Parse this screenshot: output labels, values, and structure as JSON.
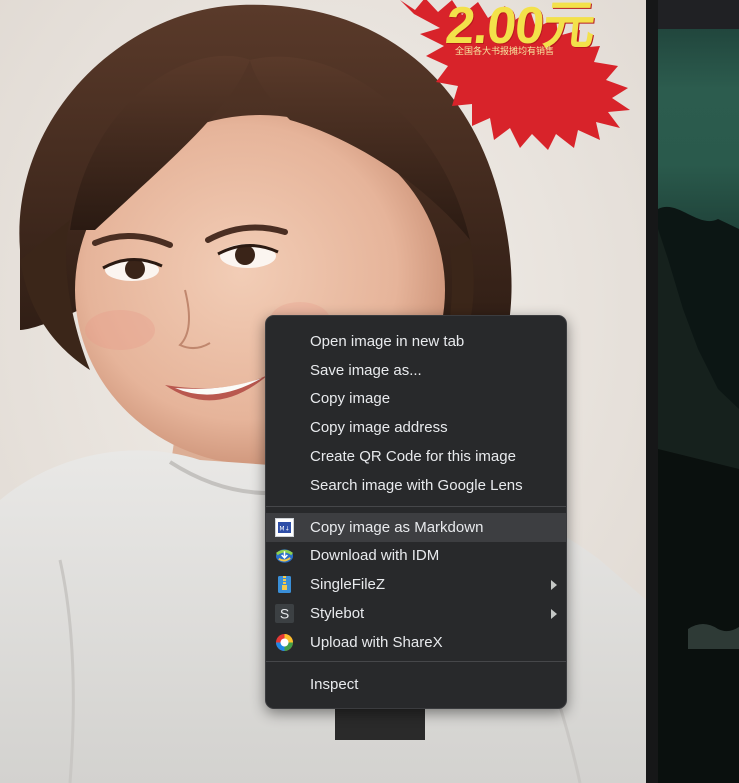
{
  "photo": {
    "price_text": "2.00元",
    "price_subtext": "全国各大书报摊均有销售"
  },
  "menu": {
    "group1": [
      {
        "label": "Open image in new tab"
      },
      {
        "label": "Save image as..."
      },
      {
        "label": "Copy image"
      },
      {
        "label": "Copy image address"
      },
      {
        "label": "Create QR Code for this image"
      },
      {
        "label": "Search image with Google Lens"
      }
    ],
    "group2": [
      {
        "label": "Copy image as Markdown",
        "icon": "markdown-extension-icon",
        "hovered": true
      },
      {
        "label": "Download with IDM",
        "icon": "idm-icon"
      },
      {
        "label": "SingleFileZ",
        "icon": "singlefilez-icon",
        "submenu": true
      },
      {
        "label": "Stylebot",
        "icon": "stylebot-icon",
        "icon_letter": "S",
        "submenu": true
      },
      {
        "label": "Upload with ShareX",
        "icon": "sharex-icon"
      }
    ],
    "group3": [
      {
        "label": "Inspect"
      }
    ]
  },
  "colors": {
    "menu_bg": "#28292b",
    "menu_text": "#e8eaed",
    "hover_bg": "#3d3e41",
    "price_yellow": "#f3e14a",
    "starburst_red": "#d8232a"
  }
}
